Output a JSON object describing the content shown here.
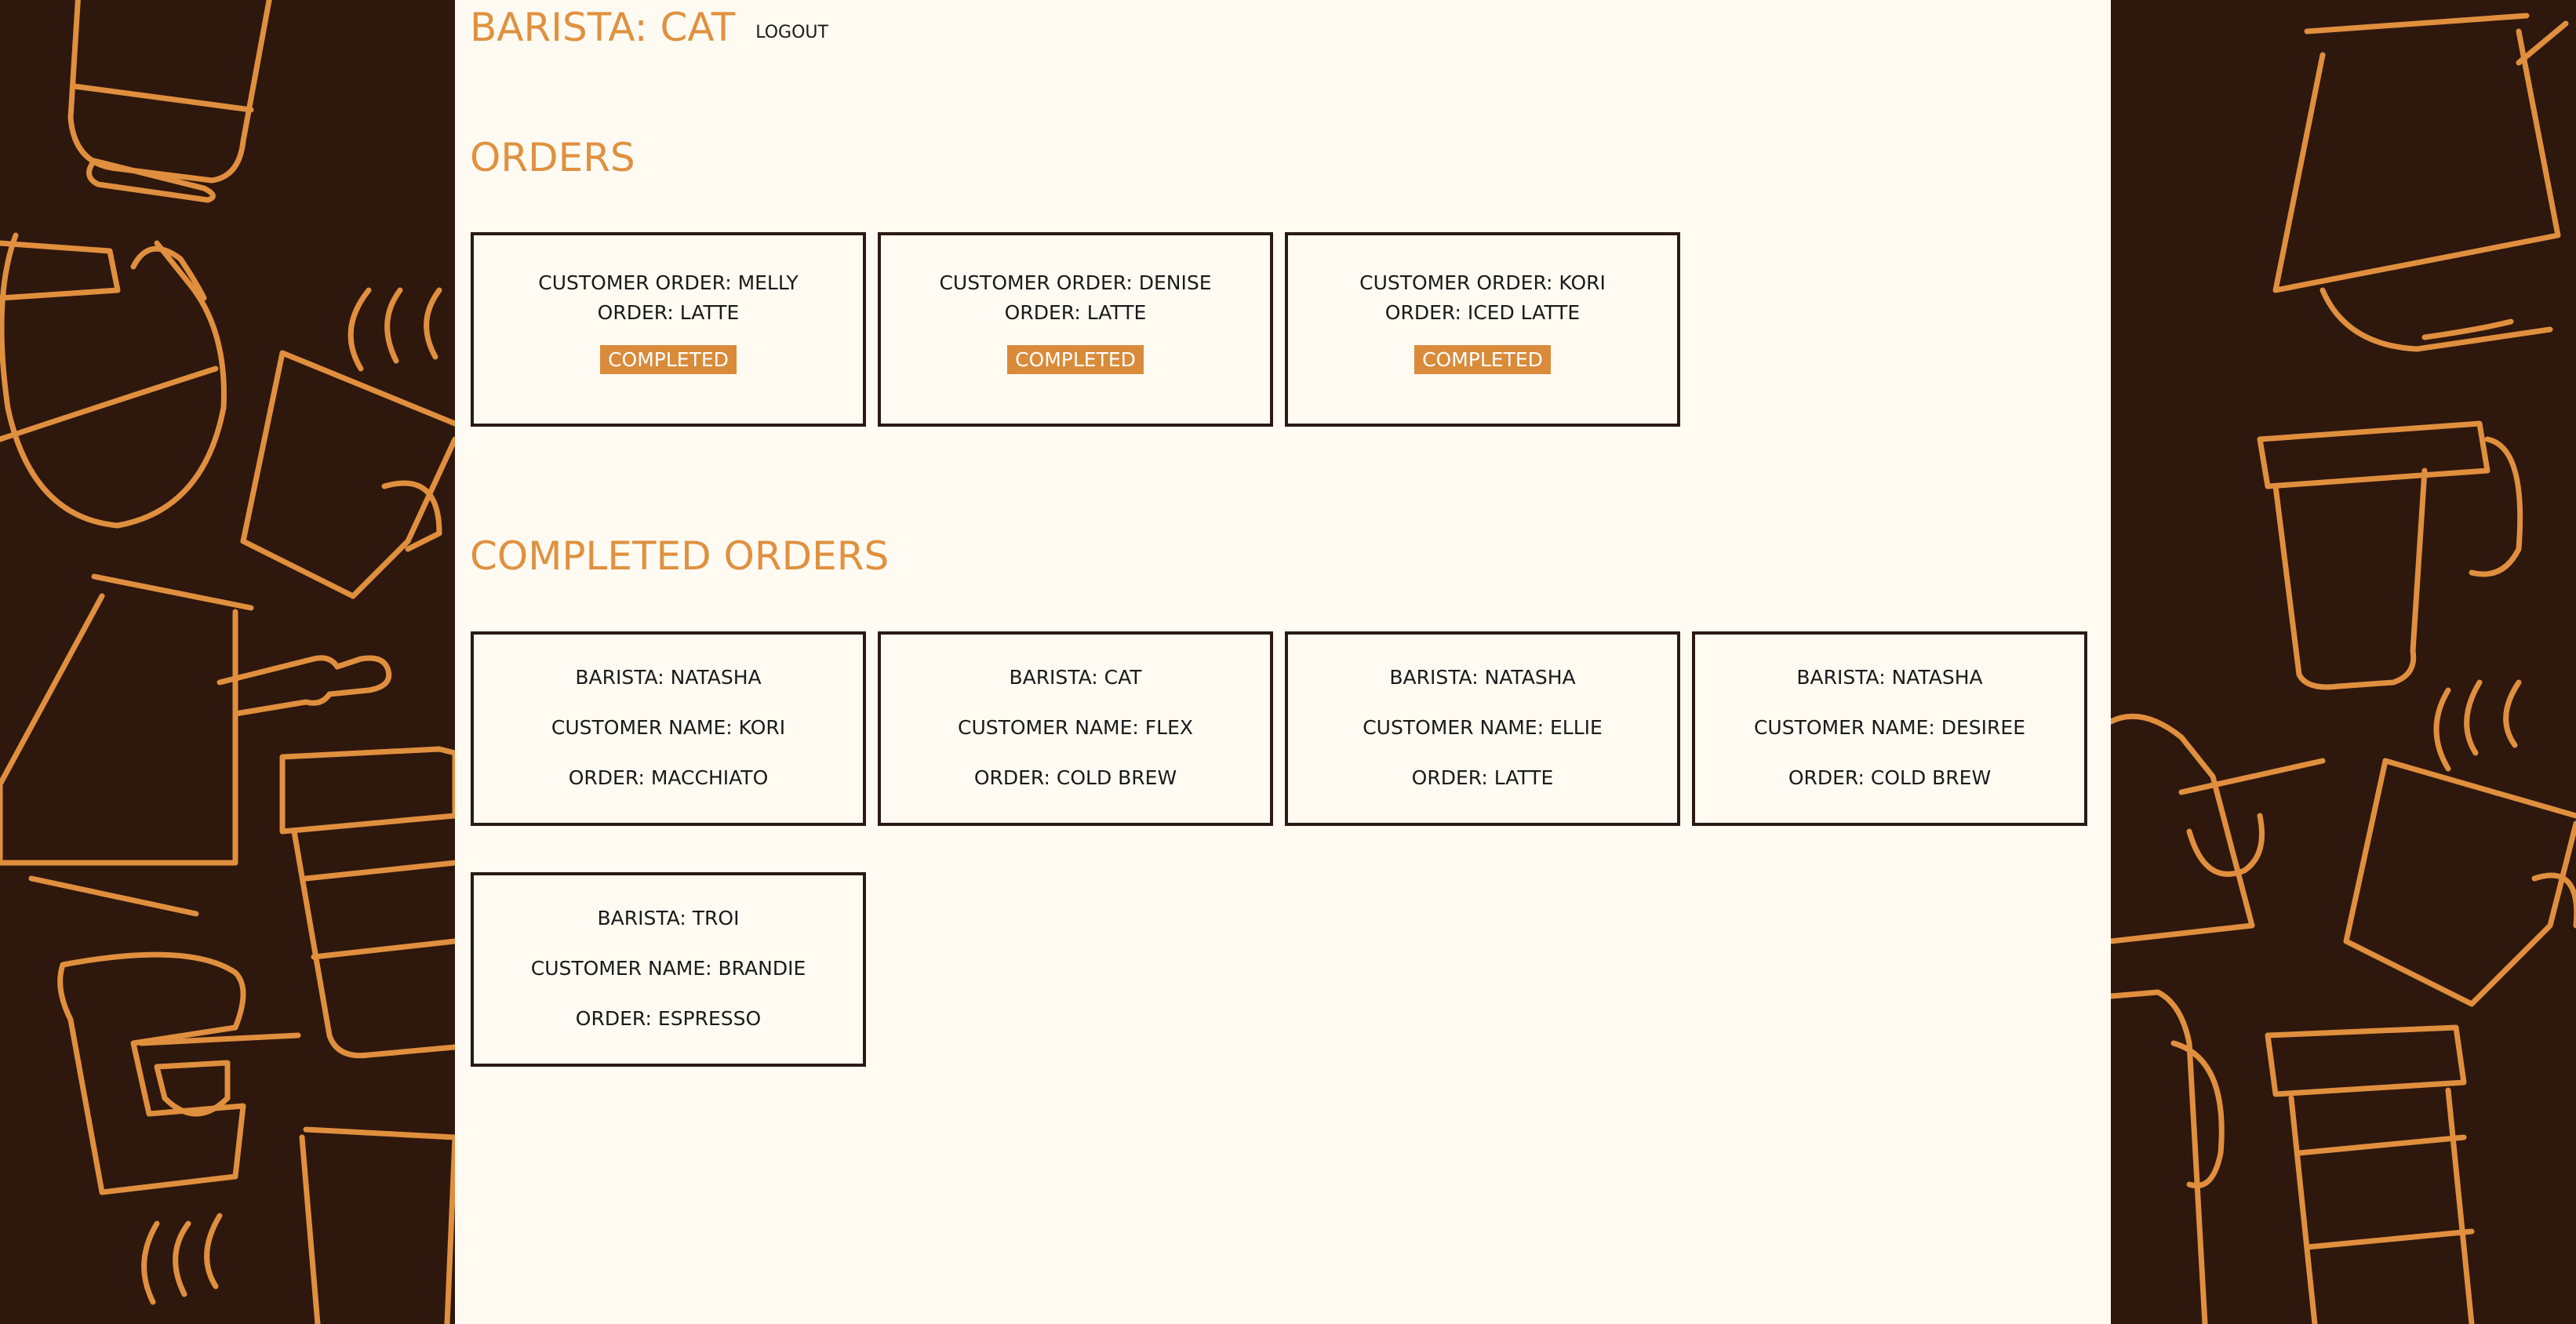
{
  "header": {
    "title": "BARISTA: CAT",
    "logout_label": "LOGOUT"
  },
  "orders": {
    "title": "ORDERS",
    "items": [
      {
        "customer": "CUSTOMER ORDER: MELLY",
        "order": "ORDER: LATTE",
        "button": "COMPLETED"
      },
      {
        "customer": "CUSTOMER ORDER: DENISE",
        "order": "ORDER: LATTE",
        "button": "COMPLETED"
      },
      {
        "customer": "CUSTOMER ORDER: KORI",
        "order": "ORDER: ICED LATTE",
        "button": "COMPLETED"
      }
    ]
  },
  "completed": {
    "title": "COMPLETED ORDERS",
    "items": [
      {
        "barista": "BARISTA: NATASHA",
        "customer": "CUSTOMER NAME: KORI",
        "order": "ORDER: MACCHIATO"
      },
      {
        "barista": "BARISTA: CAT",
        "customer": "CUSTOMER NAME: FLEX",
        "order": "ORDER: COLD BREW"
      },
      {
        "barista": "BARISTA: NATASHA",
        "customer": "CUSTOMER NAME: ELLIE",
        "order": "ORDER: LATTE"
      },
      {
        "barista": "BARISTA: NATASHA",
        "customer": "CUSTOMER NAME: DESIREE",
        "order": "ORDER: COLD BREW"
      },
      {
        "barista": "BARISTA: TROI",
        "customer": "CUSTOMER NAME: BRANDIE",
        "order": "ORDER: ESPRESSO"
      }
    ]
  },
  "colors": {
    "accent": "#e0913f",
    "button": "#d98b3a",
    "page_bg": "#fffbf3",
    "side_bg": "#2e170d"
  },
  "icons": [
    "coffee-pattern-background"
  ]
}
